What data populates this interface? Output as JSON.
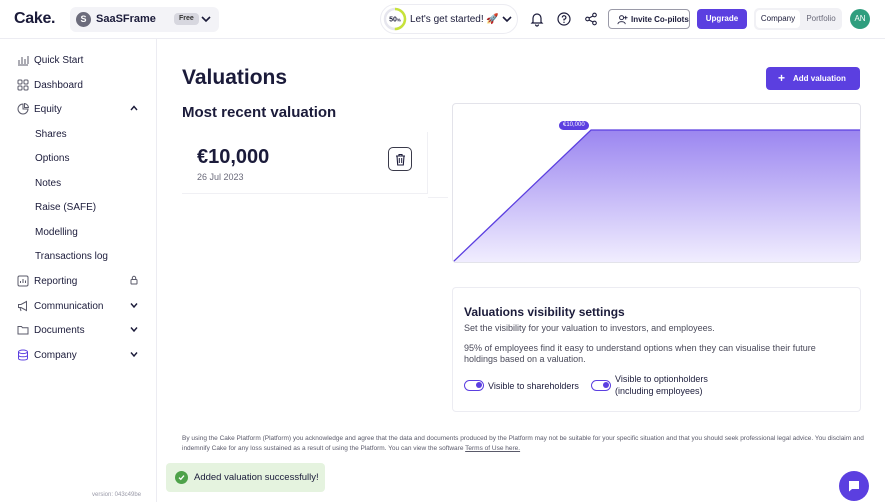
{
  "app": {
    "logo": "Cake.",
    "company_avatar": "S",
    "company_name": "SaaSFrame",
    "plan": "Free",
    "progress_value": "50",
    "progress_unit": "%",
    "progress_fraction": 0.5,
    "progress_text": "Let's get started! 🚀",
    "invite_label": "Invite Co-pilots",
    "upgrade_label": "Upgrade",
    "mode_company": "Company",
    "mode_portfolio": "Portfolio",
    "user_initials": "AN",
    "accent": "#5b3fe0"
  },
  "sidebar": {
    "items": [
      {
        "label": "Quick Start",
        "icon": "rocket-icon"
      },
      {
        "label": "Dashboard",
        "icon": "grid-icon"
      },
      {
        "label": "Equity",
        "icon": "pie-chart-icon",
        "expanded": true
      },
      {
        "label": "Reporting",
        "icon": "report-icon",
        "locked": true
      },
      {
        "label": "Communication",
        "icon": "megaphone-icon"
      },
      {
        "label": "Documents",
        "icon": "folder-icon"
      },
      {
        "label": "Company",
        "icon": "database-icon"
      }
    ],
    "equity_sub": [
      "Shares",
      "Options",
      "Notes",
      "Raise (SAFE)",
      "Modelling",
      "Transactions log"
    ],
    "version": "version: 043c49be"
  },
  "main": {
    "title": "Valuations",
    "add_label": "Add valuation",
    "recent_title": "Most recent valuation",
    "amount": "€10,000",
    "date": "26 Jul 2023",
    "chart_label": "€10,000"
  },
  "visibility": {
    "title": "Valuations visibility settings",
    "desc": "Set the visibility for your valuation to investors, and employees.",
    "note": "95% of employees find it easy to understand options when they can visualise their future holdings based on a valuation.",
    "toggle1": "Visible to shareholders",
    "toggle2_line1": "Visible to optionholders",
    "toggle2_line2": "(including employees)"
  },
  "footer": {
    "disclaimer": "By using the Cake Platform (Platform) you acknowledge and agree that the data and documents produced by the Platform may not be suitable for your specific situation and that you should seek professional legal advice. You disclaim and indemnify Cake for any loss sustained as a result of using the Platform. You can view the software ",
    "terms_link": "Terms of Use here."
  },
  "toast": {
    "message": "Added valuation successfully!"
  }
}
